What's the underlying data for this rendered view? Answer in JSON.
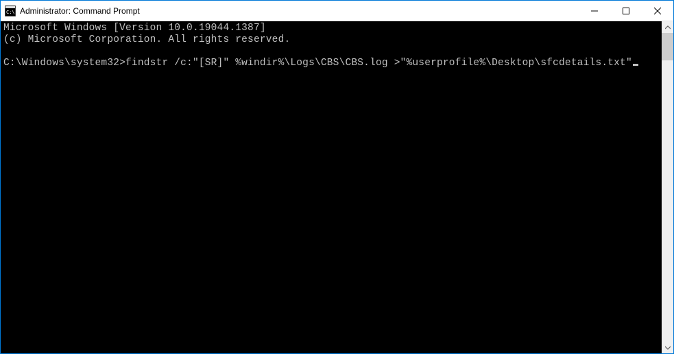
{
  "titlebar": {
    "title": "Administrator: Command Prompt"
  },
  "terminal": {
    "line1": "Microsoft Windows [Version 10.0.19044.1387]",
    "line2": "(c) Microsoft Corporation. All rights reserved.",
    "prompt": "C:\\Windows\\system32>",
    "command": "findstr /c:\"[SR]\" %windir%\\Logs\\CBS\\CBS.log >\"%userprofile%\\Desktop\\sfcdetails.txt\""
  }
}
